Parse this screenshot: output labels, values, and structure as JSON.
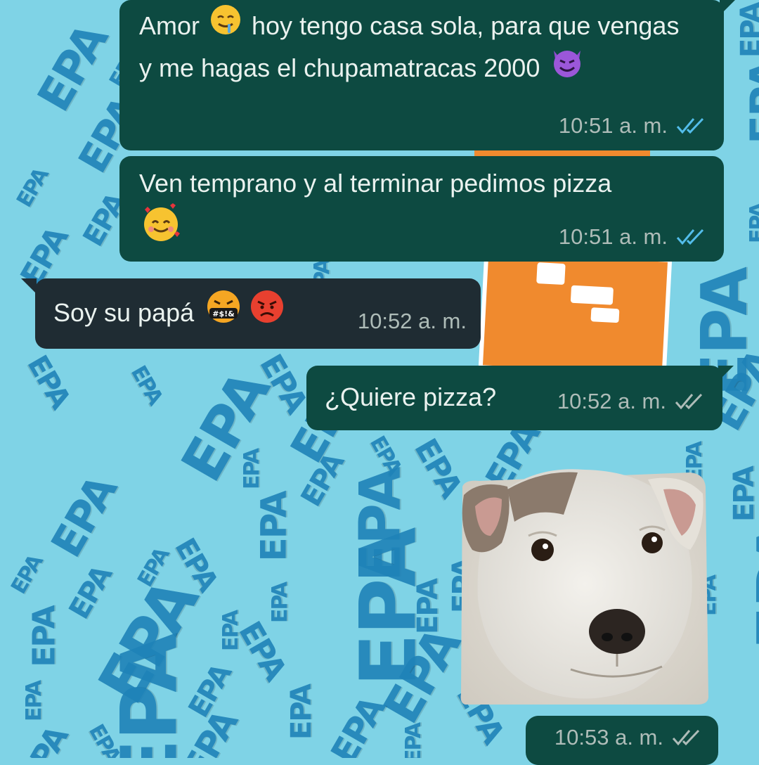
{
  "wallpaper": {
    "watermark_text": "EPA"
  },
  "messages": [
    {
      "direction": "out",
      "text_before": "Amor ",
      "emoji1": "drooling-face",
      "text_mid": " hoy tengo casa sola, para que vengas y me hagas el chupamatracas 2000 ",
      "emoji2": "smiling-devil",
      "time": "10:51 a. m.",
      "status": "read"
    },
    {
      "direction": "out",
      "text": "Ven temprano y al terminar pedimos pizza",
      "emoji": "smiling-face-with-hearts",
      "time": "10:51 a. m.",
      "status": "read"
    },
    {
      "direction": "in",
      "text": "Soy su papá",
      "emoji1": "face-with-symbols-on-mouth",
      "emoji2": "angry-face",
      "time": "10:52 a. m."
    },
    {
      "direction": "out",
      "text": "¿Quiere pizza?",
      "time": "10:52 a. m.",
      "status": "delivered"
    },
    {
      "direction": "out",
      "type": "sticker",
      "sticker": "white-pitbull-dog-sticker",
      "time": "10:53 a. m.",
      "status": "delivered"
    }
  ],
  "colors": {
    "outgoing_bubble": "#0d4a41",
    "incoming_bubble": "#1f2c33",
    "read_ticks": "#53bdeb",
    "delivered_ticks": "#aebcb8",
    "wallpaper": "#7fd3e6"
  }
}
